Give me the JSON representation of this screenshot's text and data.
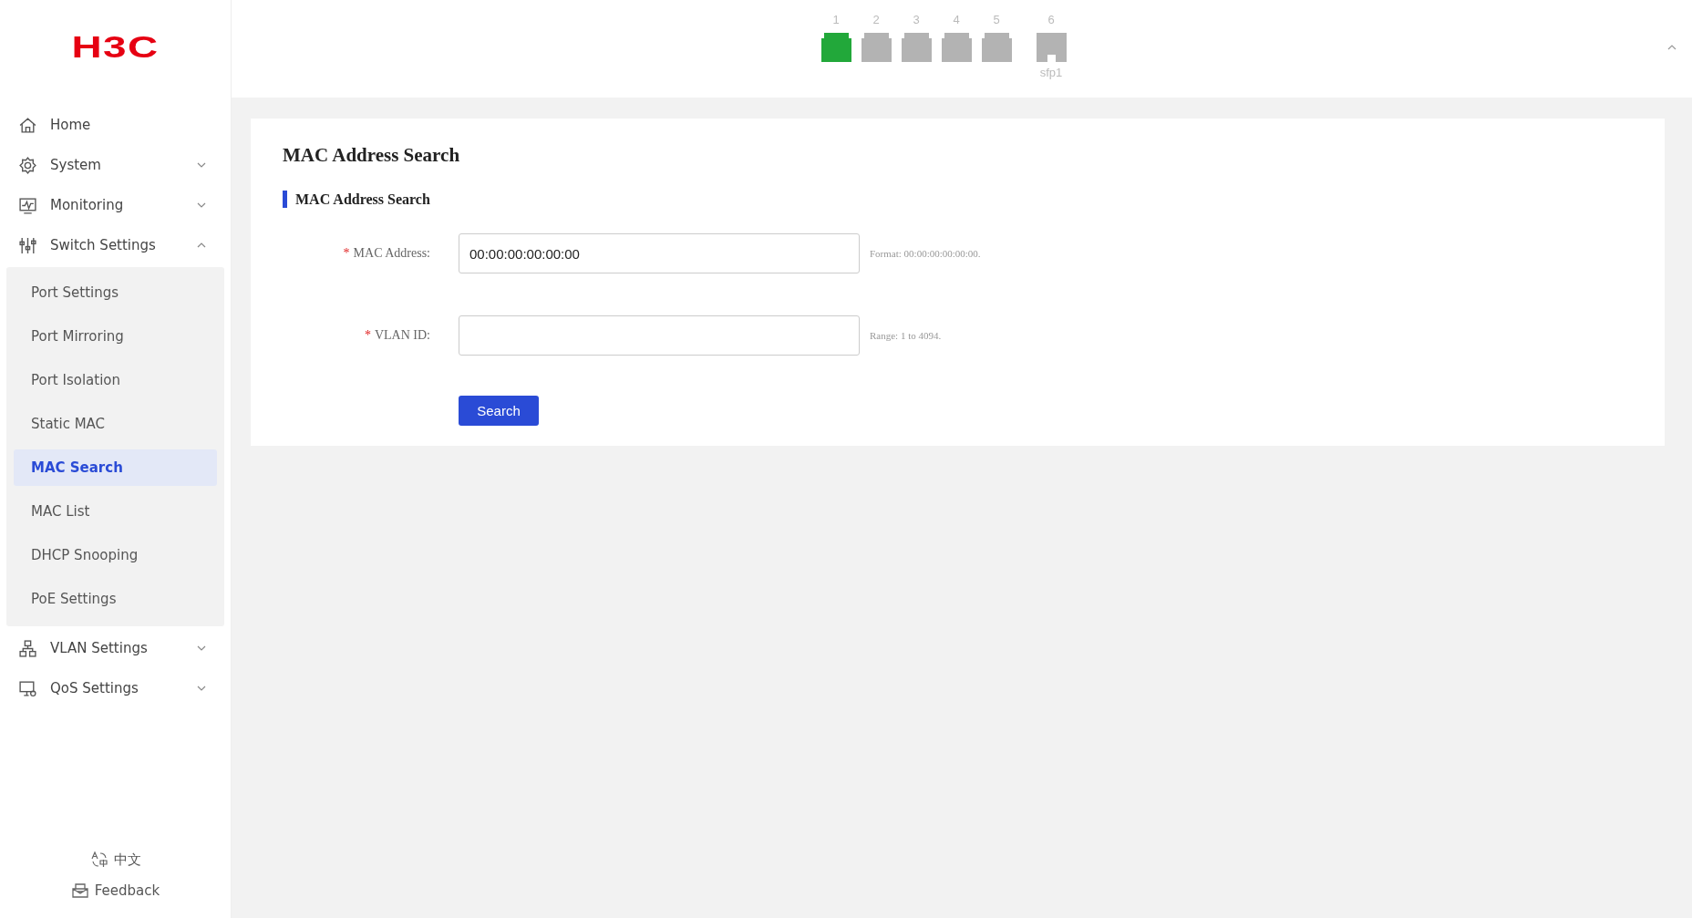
{
  "logo": "H3C",
  "sidebar": {
    "items": [
      {
        "label": "Home"
      },
      {
        "label": "System",
        "expanded": false
      },
      {
        "label": "Monitoring",
        "expanded": false
      },
      {
        "label": "Switch Settings",
        "expanded": true,
        "children": [
          {
            "label": "Port Settings",
            "selected": false
          },
          {
            "label": "Port Mirroring",
            "selected": false
          },
          {
            "label": "Port Isolation",
            "selected": false
          },
          {
            "label": "Static MAC",
            "selected": false
          },
          {
            "label": "MAC Search",
            "selected": true
          },
          {
            "label": "MAC List",
            "selected": false
          },
          {
            "label": "DHCP Snooping",
            "selected": false
          },
          {
            "label": "PoE Settings",
            "selected": false
          }
        ]
      },
      {
        "label": "VLAN Settings",
        "expanded": false
      },
      {
        "label": "QoS Settings",
        "expanded": false
      }
    ],
    "footer": {
      "language": "中文",
      "feedback": "Feedback"
    }
  },
  "ports": [
    {
      "number": "1",
      "kind": "rj45",
      "connected": true
    },
    {
      "number": "2",
      "kind": "rj45",
      "connected": false
    },
    {
      "number": "3",
      "kind": "rj45",
      "connected": false
    },
    {
      "number": "4",
      "kind": "rj45",
      "connected": false
    },
    {
      "number": "5",
      "kind": "rj45",
      "connected": false
    },
    {
      "number": "6",
      "kind": "sfp",
      "connected": false,
      "name": "sfp1"
    }
  ],
  "page": {
    "title": "MAC Address Search",
    "section": "MAC Address Search",
    "fields": [
      {
        "required_mark": "*",
        "label": "MAC Address:",
        "value": "00:00:00:00:00:00",
        "hint": "Format: 00:00:00:00:00:00."
      },
      {
        "required_mark": "*",
        "label": "VLAN ID:",
        "hint": "Range: 1 to 4094."
      }
    ],
    "button": "Search"
  }
}
